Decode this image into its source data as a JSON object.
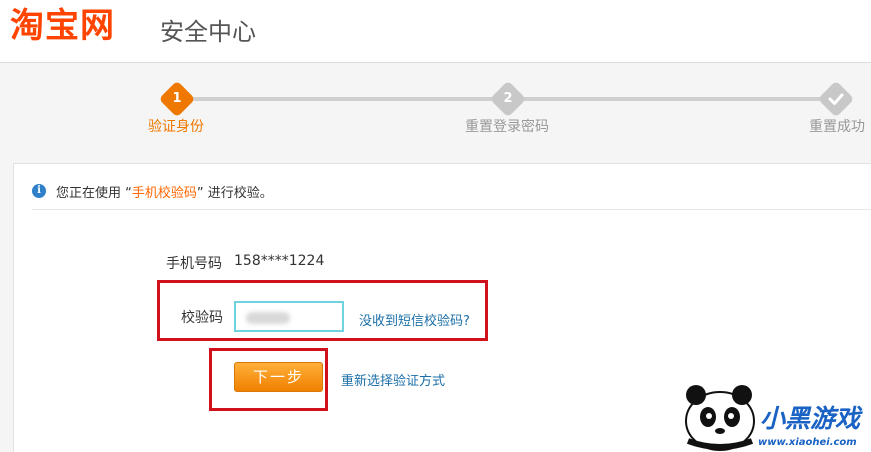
{
  "header": {
    "logo": "淘宝网",
    "title": "安全中心"
  },
  "steps": [
    {
      "number": "1",
      "label": "验证身份",
      "state": "active",
      "color": "#ee7800"
    },
    {
      "number": "2",
      "label": "重置登录密码",
      "state": "pending",
      "color": "#cfcfcf"
    },
    {
      "number": "",
      "icon": "check-icon",
      "label": "重置成功",
      "state": "pending",
      "color": "#cfcfcf"
    }
  ],
  "notice": {
    "prefix": "您正在使用 “",
    "method": "手机校验码",
    "suffix": "” 进行校验。"
  },
  "form": {
    "phone_label": "手机号码",
    "phone_value": "158****1224",
    "code_label": "校验码",
    "code_value": "",
    "resend_link": "没收到短信校验码?",
    "next_button": "下一步",
    "change_method_link": "重新选择验证方式"
  },
  "watermark": {
    "brand": "小黑游戏",
    "url": "www.xiaohei.com"
  },
  "colors": {
    "brand": "#ff4400",
    "active_step": "#ee7800",
    "link": "#1b6fa8",
    "highlight_box": "#d0101b"
  }
}
